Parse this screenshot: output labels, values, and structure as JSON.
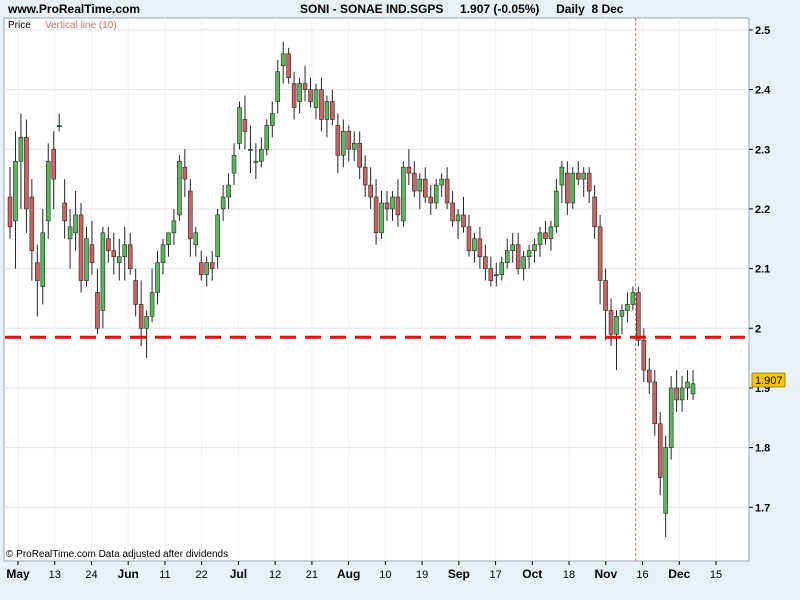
{
  "header": {
    "site": "www.ProRealTime.com",
    "instrument": "SONI - SONAE IND.SGPS",
    "last_change": "1.907 (-0.05%)",
    "period": "Daily",
    "date": "8 Dec"
  },
  "legend": {
    "price": "Price",
    "vertical_line": "Vertical line (10)"
  },
  "footer": {
    "copyright": "© ProRealTime.com  Data adjusted after dividends"
  },
  "colors": {
    "up": "#5cb85c",
    "down": "#c86464",
    "hline": "#e01010",
    "vline": "#d07070",
    "price_tag": "#f5c400"
  },
  "chart_data": {
    "type": "candlestick",
    "ylim": [
      1.61,
      2.52
    ],
    "yticks": [
      1.7,
      1.8,
      1.9,
      2.0,
      2.1,
      2.2,
      2.3,
      2.4,
      2.5
    ],
    "ytick_labels": [
      "1.7",
      "1.8",
      "1.9",
      "2",
      "2.1",
      "2.2",
      "2.3",
      "2.4",
      "2.5"
    ],
    "xlabels": [
      "May",
      "13",
      "24",
      "Jun",
      "11",
      "22",
      "Jul",
      "12",
      "21",
      "Aug",
      "10",
      "19",
      "Sep",
      "17",
      "Oct",
      "18",
      "Nov",
      "16",
      "Dec",
      "15"
    ],
    "xlabel_bold": [
      "May",
      "Jun",
      "Jul",
      "Aug",
      "Sep",
      "Oct",
      "Nov",
      "Dec"
    ],
    "last_price": "1.907",
    "last_price_value": 1.907,
    "horizontal_line": 1.985,
    "candles": [
      [
        2.22,
        2.27,
        2.15,
        2.17
      ],
      [
        2.18,
        2.33,
        2.1,
        2.28
      ],
      [
        2.28,
        2.36,
        2.2,
        2.32
      ],
      [
        2.32,
        2.35,
        2.16,
        2.2
      ],
      [
        2.22,
        2.25,
        2.08,
        2.13
      ],
      [
        2.11,
        2.14,
        2.02,
        2.08
      ],
      [
        2.07,
        2.2,
        2.04,
        2.16
      ],
      [
        2.18,
        2.31,
        2.15,
        2.28
      ],
      [
        2.3,
        2.33,
        2.2,
        2.25
      ],
      [
        2.34,
        2.36,
        2.33,
        2.34
      ],
      [
        2.21,
        2.25,
        2.15,
        2.18
      ],
      [
        2.15,
        2.2,
        2.1,
        2.17
      ],
      [
        2.16,
        2.23,
        2.13,
        2.19
      ],
      [
        2.19,
        2.21,
        2.06,
        2.08
      ],
      [
        2.08,
        2.17,
        2.07,
        2.15
      ],
      [
        2.14,
        2.18,
        2.09,
        2.11
      ],
      [
        2.06,
        2.1,
        1.99,
        2.0
      ],
      [
        2.03,
        2.17,
        2.0,
        2.16
      ],
      [
        2.15,
        2.17,
        2.11,
        2.13
      ],
      [
        2.13,
        2.16,
        2.09,
        2.12
      ],
      [
        2.11,
        2.15,
        2.08,
        2.12
      ],
      [
        2.12,
        2.17,
        2.08,
        2.14
      ],
      [
        2.14,
        2.16,
        2.09,
        2.1
      ],
      [
        2.08,
        2.1,
        2.02,
        2.04
      ],
      [
        2.04,
        2.08,
        1.97,
        2.0
      ],
      [
        2.0,
        2.03,
        1.95,
        2.02
      ],
      [
        2.02,
        2.1,
        2.01,
        2.06
      ],
      [
        2.06,
        2.13,
        2.04,
        2.11
      ],
      [
        2.11,
        2.15,
        2.09,
        2.14
      ],
      [
        2.14,
        2.16,
        2.12,
        2.16
      ],
      [
        2.16,
        2.2,
        2.14,
        2.18
      ],
      [
        2.19,
        2.29,
        2.18,
        2.28
      ],
      [
        2.27,
        2.3,
        2.22,
        2.25
      ],
      [
        2.23,
        2.25,
        2.12,
        2.15
      ],
      [
        2.14,
        2.17,
        2.12,
        2.16
      ],
      [
        2.11,
        2.13,
        2.08,
        2.09
      ],
      [
        2.09,
        2.12,
        2.07,
        2.11
      ],
      [
        2.11,
        2.13,
        2.08,
        2.1
      ],
      [
        2.12,
        2.2,
        2.1,
        2.19
      ],
      [
        2.2,
        2.24,
        2.18,
        2.22
      ],
      [
        2.22,
        2.26,
        2.2,
        2.24
      ],
      [
        2.26,
        2.31,
        2.24,
        2.29
      ],
      [
        2.31,
        2.38,
        2.3,
        2.37
      ],
      [
        2.35,
        2.39,
        2.3,
        2.33
      ],
      [
        2.3,
        2.34,
        2.26,
        2.3
      ],
      [
        2.28,
        2.31,
        2.25,
        2.28
      ],
      [
        2.28,
        2.32,
        2.27,
        2.3
      ],
      [
        2.3,
        2.35,
        2.29,
        2.34
      ],
      [
        2.34,
        2.38,
        2.32,
        2.36
      ],
      [
        2.38,
        2.45,
        2.36,
        2.43
      ],
      [
        2.44,
        2.48,
        2.41,
        2.46
      ],
      [
        2.46,
        2.47,
        2.41,
        2.42
      ],
      [
        2.41,
        2.43,
        2.35,
        2.37
      ],
      [
        2.38,
        2.42,
        2.36,
        2.41
      ],
      [
        2.41,
        2.44,
        2.38,
        2.4
      ],
      [
        2.4,
        2.42,
        2.37,
        2.38
      ],
      [
        2.37,
        2.41,
        2.35,
        2.4
      ],
      [
        2.4,
        2.42,
        2.33,
        2.35
      ],
      [
        2.35,
        2.39,
        2.32,
        2.38
      ],
      [
        2.38,
        2.4,
        2.34,
        2.35
      ],
      [
        2.34,
        2.36,
        2.26,
        2.29
      ],
      [
        2.29,
        2.35,
        2.27,
        2.33
      ],
      [
        2.33,
        2.34,
        2.28,
        2.3
      ],
      [
        2.3,
        2.33,
        2.28,
        2.31
      ],
      [
        2.31,
        2.33,
        2.25,
        2.27
      ],
      [
        2.27,
        2.29,
        2.22,
        2.24
      ],
      [
        2.24,
        2.27,
        2.2,
        2.22
      ],
      [
        2.22,
        2.25,
        2.14,
        2.16
      ],
      [
        2.16,
        2.23,
        2.15,
        2.21
      ],
      [
        2.21,
        2.23,
        2.18,
        2.2
      ],
      [
        2.2,
        2.23,
        2.18,
        2.22
      ],
      [
        2.22,
        2.25,
        2.17,
        2.19
      ],
      [
        2.18,
        2.28,
        2.17,
        2.27
      ],
      [
        2.27,
        2.3,
        2.24,
        2.26
      ],
      [
        2.26,
        2.28,
        2.22,
        2.23
      ],
      [
        2.23,
        2.26,
        2.2,
        2.25
      ],
      [
        2.25,
        2.27,
        2.21,
        2.22
      ],
      [
        2.22,
        2.24,
        2.19,
        2.21
      ],
      [
        2.21,
        2.25,
        2.2,
        2.24
      ],
      [
        2.24,
        2.26,
        2.22,
        2.25
      ],
      [
        2.25,
        2.27,
        2.2,
        2.21
      ],
      [
        2.21,
        2.23,
        2.17,
        2.18
      ],
      [
        2.18,
        2.2,
        2.15,
        2.19
      ],
      [
        2.19,
        2.22,
        2.16,
        2.17
      ],
      [
        2.17,
        2.19,
        2.12,
        2.13
      ],
      [
        2.13,
        2.16,
        2.11,
        2.15
      ],
      [
        2.15,
        2.17,
        2.1,
        2.12
      ],
      [
        2.12,
        2.14,
        2.08,
        2.1
      ],
      [
        2.1,
        2.12,
        2.07,
        2.08
      ],
      [
        2.09,
        2.11,
        2.07,
        2.09
      ],
      [
        2.09,
        2.12,
        2.08,
        2.11
      ],
      [
        2.11,
        2.15,
        2.1,
        2.13
      ],
      [
        2.13,
        2.16,
        2.11,
        2.14
      ],
      [
        2.14,
        2.16,
        2.09,
        2.1
      ],
      [
        2.1,
        2.13,
        2.08,
        2.12
      ],
      [
        2.12,
        2.14,
        2.1,
        2.13
      ],
      [
        2.13,
        2.15,
        2.11,
        2.14
      ],
      [
        2.14,
        2.17,
        2.12,
        2.16
      ],
      [
        2.16,
        2.18,
        2.14,
        2.15
      ],
      [
        2.15,
        2.18,
        2.13,
        2.17
      ],
      [
        2.17,
        2.25,
        2.16,
        2.23
      ],
      [
        2.24,
        2.28,
        2.21,
        2.27
      ],
      [
        2.26,
        2.28,
        2.19,
        2.21
      ],
      [
        2.21,
        2.27,
        2.2,
        2.26
      ],
      [
        2.26,
        2.28,
        2.24,
        2.25
      ],
      [
        2.25,
        2.27,
        2.22,
        2.26
      ],
      [
        2.26,
        2.27,
        2.21,
        2.23
      ],
      [
        2.22,
        2.24,
        2.15,
        2.17
      ],
      [
        2.17,
        2.19,
        2.04,
        2.08
      ],
      [
        2.08,
        2.1,
        1.98,
        2.03
      ],
      [
        2.03,
        2.05,
        1.97,
        1.99
      ],
      [
        1.99,
        2.03,
        1.93,
        2.02
      ],
      [
        2.02,
        2.04,
        1.99,
        2.03
      ],
      [
        2.03,
        2.06,
        2.01,
        2.04
      ],
      [
        2.04,
        2.07,
        2.03,
        2.06
      ],
      [
        2.06,
        2.07,
        1.97,
        1.98
      ],
      [
        1.98,
        2.0,
        1.91,
        1.93
      ],
      [
        1.93,
        1.95,
        1.89,
        1.91
      ],
      [
        1.91,
        1.93,
        1.82,
        1.84
      ],
      [
        1.84,
        1.86,
        1.72,
        1.75
      ],
      [
        1.69,
        1.82,
        1.65,
        1.8
      ],
      [
        1.8,
        1.92,
        1.78,
        1.9
      ],
      [
        1.9,
        1.93,
        1.86,
        1.88
      ],
      [
        1.88,
        1.92,
        1.86,
        1.9
      ],
      [
        1.9,
        1.93,
        1.88,
        1.91
      ],
      [
        1.89,
        1.93,
        1.88,
        1.907
      ]
    ]
  }
}
